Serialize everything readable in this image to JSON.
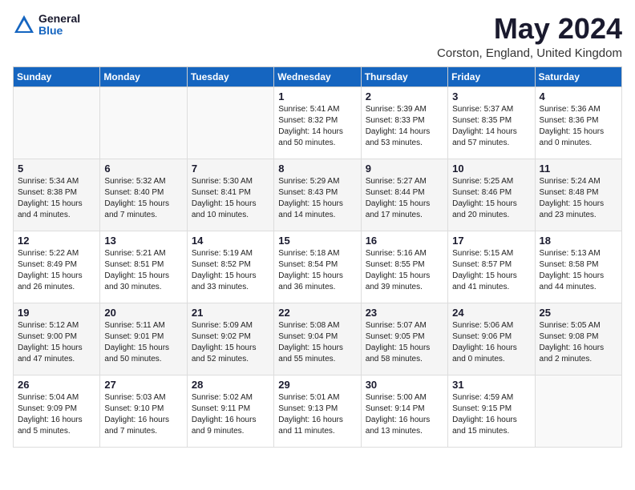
{
  "logo": {
    "general": "General",
    "blue": "Blue"
  },
  "title": "May 2024",
  "location": "Corston, England, United Kingdom",
  "days_of_week": [
    "Sunday",
    "Monday",
    "Tuesday",
    "Wednesday",
    "Thursday",
    "Friday",
    "Saturday"
  ],
  "weeks": [
    [
      {
        "day": "",
        "info": ""
      },
      {
        "day": "",
        "info": ""
      },
      {
        "day": "",
        "info": ""
      },
      {
        "day": "1",
        "info": "Sunrise: 5:41 AM\nSunset: 8:32 PM\nDaylight: 14 hours\nand 50 minutes."
      },
      {
        "day": "2",
        "info": "Sunrise: 5:39 AM\nSunset: 8:33 PM\nDaylight: 14 hours\nand 53 minutes."
      },
      {
        "day": "3",
        "info": "Sunrise: 5:37 AM\nSunset: 8:35 PM\nDaylight: 14 hours\nand 57 minutes."
      },
      {
        "day": "4",
        "info": "Sunrise: 5:36 AM\nSunset: 8:36 PM\nDaylight: 15 hours\nand 0 minutes."
      }
    ],
    [
      {
        "day": "5",
        "info": "Sunrise: 5:34 AM\nSunset: 8:38 PM\nDaylight: 15 hours\nand 4 minutes."
      },
      {
        "day": "6",
        "info": "Sunrise: 5:32 AM\nSunset: 8:40 PM\nDaylight: 15 hours\nand 7 minutes."
      },
      {
        "day": "7",
        "info": "Sunrise: 5:30 AM\nSunset: 8:41 PM\nDaylight: 15 hours\nand 10 minutes."
      },
      {
        "day": "8",
        "info": "Sunrise: 5:29 AM\nSunset: 8:43 PM\nDaylight: 15 hours\nand 14 minutes."
      },
      {
        "day": "9",
        "info": "Sunrise: 5:27 AM\nSunset: 8:44 PM\nDaylight: 15 hours\nand 17 minutes."
      },
      {
        "day": "10",
        "info": "Sunrise: 5:25 AM\nSunset: 8:46 PM\nDaylight: 15 hours\nand 20 minutes."
      },
      {
        "day": "11",
        "info": "Sunrise: 5:24 AM\nSunset: 8:48 PM\nDaylight: 15 hours\nand 23 minutes."
      }
    ],
    [
      {
        "day": "12",
        "info": "Sunrise: 5:22 AM\nSunset: 8:49 PM\nDaylight: 15 hours\nand 26 minutes."
      },
      {
        "day": "13",
        "info": "Sunrise: 5:21 AM\nSunset: 8:51 PM\nDaylight: 15 hours\nand 30 minutes."
      },
      {
        "day": "14",
        "info": "Sunrise: 5:19 AM\nSunset: 8:52 PM\nDaylight: 15 hours\nand 33 minutes."
      },
      {
        "day": "15",
        "info": "Sunrise: 5:18 AM\nSunset: 8:54 PM\nDaylight: 15 hours\nand 36 minutes."
      },
      {
        "day": "16",
        "info": "Sunrise: 5:16 AM\nSunset: 8:55 PM\nDaylight: 15 hours\nand 39 minutes."
      },
      {
        "day": "17",
        "info": "Sunrise: 5:15 AM\nSunset: 8:57 PM\nDaylight: 15 hours\nand 41 minutes."
      },
      {
        "day": "18",
        "info": "Sunrise: 5:13 AM\nSunset: 8:58 PM\nDaylight: 15 hours\nand 44 minutes."
      }
    ],
    [
      {
        "day": "19",
        "info": "Sunrise: 5:12 AM\nSunset: 9:00 PM\nDaylight: 15 hours\nand 47 minutes."
      },
      {
        "day": "20",
        "info": "Sunrise: 5:11 AM\nSunset: 9:01 PM\nDaylight: 15 hours\nand 50 minutes."
      },
      {
        "day": "21",
        "info": "Sunrise: 5:09 AM\nSunset: 9:02 PM\nDaylight: 15 hours\nand 52 minutes."
      },
      {
        "day": "22",
        "info": "Sunrise: 5:08 AM\nSunset: 9:04 PM\nDaylight: 15 hours\nand 55 minutes."
      },
      {
        "day": "23",
        "info": "Sunrise: 5:07 AM\nSunset: 9:05 PM\nDaylight: 15 hours\nand 58 minutes."
      },
      {
        "day": "24",
        "info": "Sunrise: 5:06 AM\nSunset: 9:06 PM\nDaylight: 16 hours\nand 0 minutes."
      },
      {
        "day": "25",
        "info": "Sunrise: 5:05 AM\nSunset: 9:08 PM\nDaylight: 16 hours\nand 2 minutes."
      }
    ],
    [
      {
        "day": "26",
        "info": "Sunrise: 5:04 AM\nSunset: 9:09 PM\nDaylight: 16 hours\nand 5 minutes."
      },
      {
        "day": "27",
        "info": "Sunrise: 5:03 AM\nSunset: 9:10 PM\nDaylight: 16 hours\nand 7 minutes."
      },
      {
        "day": "28",
        "info": "Sunrise: 5:02 AM\nSunset: 9:11 PM\nDaylight: 16 hours\nand 9 minutes."
      },
      {
        "day": "29",
        "info": "Sunrise: 5:01 AM\nSunset: 9:13 PM\nDaylight: 16 hours\nand 11 minutes."
      },
      {
        "day": "30",
        "info": "Sunrise: 5:00 AM\nSunset: 9:14 PM\nDaylight: 16 hours\nand 13 minutes."
      },
      {
        "day": "31",
        "info": "Sunrise: 4:59 AM\nSunset: 9:15 PM\nDaylight: 16 hours\nand 15 minutes."
      },
      {
        "day": "",
        "info": ""
      }
    ]
  ]
}
